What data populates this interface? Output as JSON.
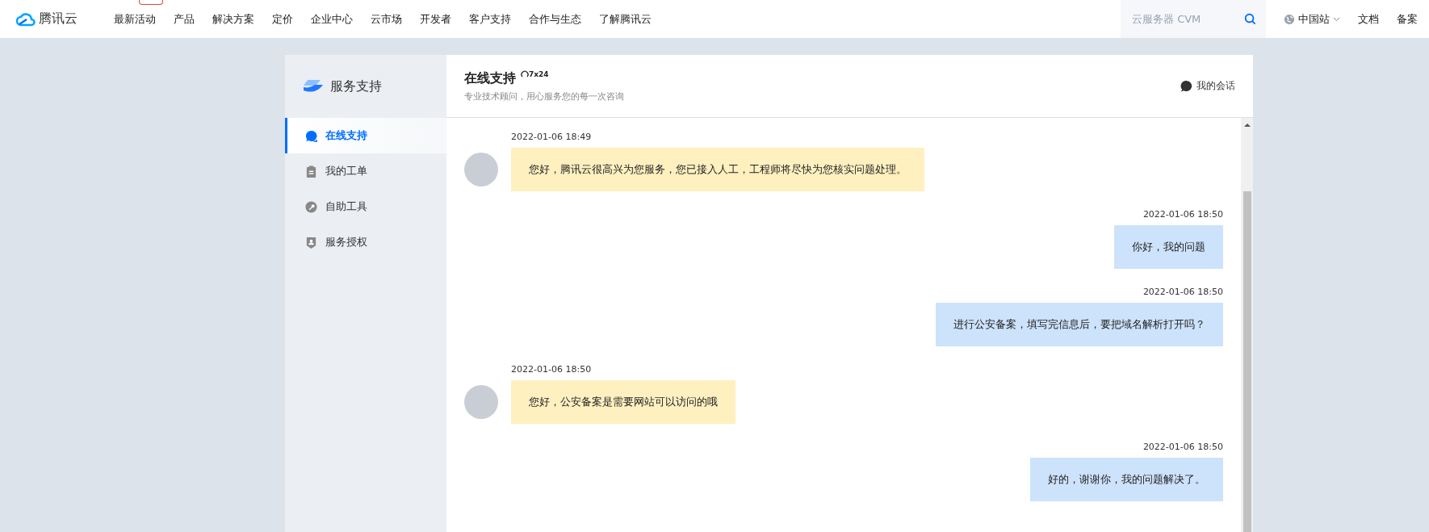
{
  "nav": {
    "logo": "腾讯云",
    "items": [
      {
        "label": "最新活动",
        "hot": true
      },
      {
        "label": "产品",
        "hot": false
      },
      {
        "label": "解决方案",
        "hot": false
      },
      {
        "label": "定价",
        "hot": false
      },
      {
        "label": "企业中心",
        "hot": false
      },
      {
        "label": "云市场",
        "hot": false
      },
      {
        "label": "开发者",
        "hot": false
      },
      {
        "label": "客户支持",
        "hot": false
      },
      {
        "label": "合作与生态",
        "hot": false
      },
      {
        "label": "了解腾讯云",
        "hot": false
      }
    ],
    "search": {
      "placeholder": "云服务器 CVM"
    },
    "region": "中国站",
    "links": [
      "文档",
      "备案"
    ]
  },
  "sidebar": {
    "title": "服务支持",
    "items": [
      {
        "label": "在线支持",
        "kind": "chat",
        "selected": true
      },
      {
        "label": "我的工单",
        "kind": "clipboard",
        "selected": false
      },
      {
        "label": "自助工具",
        "kind": "wrench",
        "selected": false
      },
      {
        "label": "服务授权",
        "kind": "shield",
        "selected": false
      }
    ]
  },
  "header": {
    "title": "在线支持",
    "badge": "7x24",
    "subtitle": "专业技术顾问，用心服务您的每一次咨询",
    "sessions": "我的会话"
  },
  "messages": [
    {
      "kind": "agent",
      "time": "2022-01-06 18:49",
      "text": "您好，腾讯云很高兴为您服务，您已接入人工，工程师将尽快为您核实问题处理。"
    },
    {
      "kind": "user",
      "time": "2022-01-06 18:50",
      "text": "你好，我的问题"
    },
    {
      "kind": "user",
      "time": "2022-01-06 18:50",
      "text": "进行公安备案，填写完信息后，要把域名解析打开吗？"
    },
    {
      "kind": "agent",
      "time": "2022-01-06 18:50",
      "text": "您好，公安备案是需要网站可以访问的哦"
    },
    {
      "kind": "user",
      "time": "2022-01-06 18:50",
      "text": "好的，谢谢你，我的问题解决了。"
    }
  ]
}
